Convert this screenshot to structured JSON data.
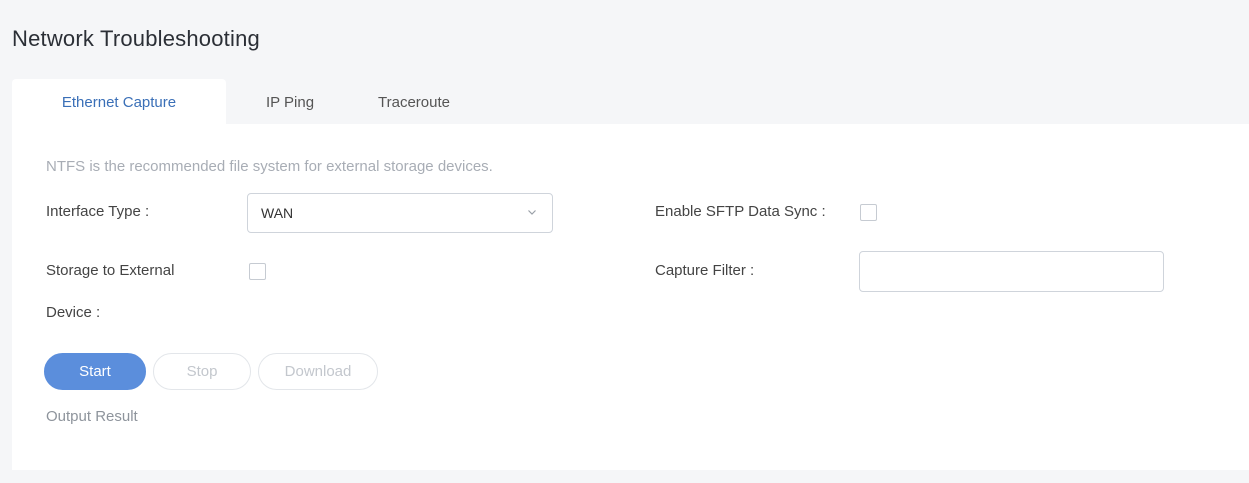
{
  "page": {
    "title": "Network Troubleshooting"
  },
  "tabs": [
    {
      "label": "Ethernet Capture",
      "active": true
    },
    {
      "label": "IP Ping",
      "active": false
    },
    {
      "label": "Traceroute",
      "active": false
    }
  ],
  "form": {
    "hint": "NTFS is the recommended file system for external storage devices.",
    "interface_type": {
      "label": "Interface Type :",
      "value": "WAN",
      "icon": "chevron-down-icon"
    },
    "storage_external": {
      "label_line1": "Storage to External",
      "label_line2": "Device :",
      "checked": false
    },
    "sftp_sync": {
      "label": "Enable SFTP Data Sync :",
      "checked": false
    },
    "capture_filter": {
      "label": "Capture Filter :",
      "value": "",
      "placeholder": ""
    }
  },
  "buttons": {
    "start": "Start",
    "stop": "Stop",
    "download": "Download"
  },
  "output": {
    "label": "Output Result"
  },
  "colors": {
    "accent": "#5b8edc",
    "active_tab_text": "#3a6fb7",
    "background": "#f5f6f8"
  }
}
